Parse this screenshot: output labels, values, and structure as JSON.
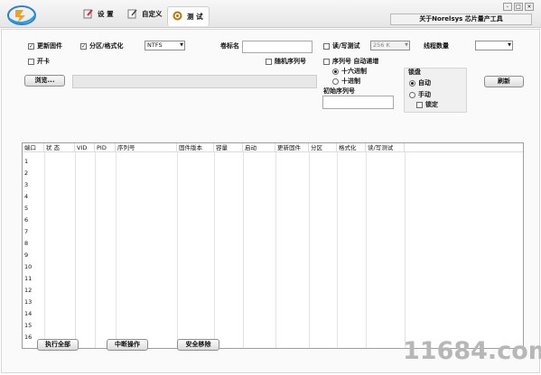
{
  "toolbar": {
    "tabs": [
      {
        "label": "设 置"
      },
      {
        "label": "自定义"
      },
      {
        "label": "测 试"
      }
    ],
    "window_title": "关于Norelsys 芯片量产工具"
  },
  "options": {
    "update_firmware": {
      "label": "更新固件",
      "checked": true
    },
    "partition_format": {
      "label": "分区/格式化",
      "checked": true
    },
    "filesystem": "NTFS",
    "volume_label": "卷标名",
    "rw_test": {
      "label": "读/写测试",
      "checked": false
    },
    "rw_size": "256 K",
    "thread_count_label": "线程数量",
    "open_card": {
      "label": "开卡",
      "checked": false
    },
    "random_serial": {
      "label": "随机序列号",
      "checked": false
    },
    "serial_increment": {
      "label": "序列号 自动递增",
      "checked": false
    },
    "hex": "十六进制",
    "dec": "十进制",
    "initial_serial": "初始序列号",
    "lock": "锁盘",
    "auto": "自动",
    "manual": "手动",
    "locked": "锁定",
    "browse": "浏览...",
    "refresh": "刷新"
  },
  "table": {
    "headers": [
      "端口",
      "状 态",
      "VID",
      "PID",
      "序列号",
      "固件版本",
      "容量",
      "启动",
      "更新固件",
      "分区",
      "格式化",
      "读/写测试"
    ],
    "rows": [
      "1",
      "2",
      "3",
      "4",
      "5",
      "6",
      "7",
      "8",
      "9",
      "10",
      "11",
      "12",
      "13",
      "14",
      "15",
      "16"
    ]
  },
  "footer": {
    "run_all": "执行全部",
    "abort": "中断操作",
    "safe_remove": "安全移除"
  },
  "watermark": "11684.com"
}
